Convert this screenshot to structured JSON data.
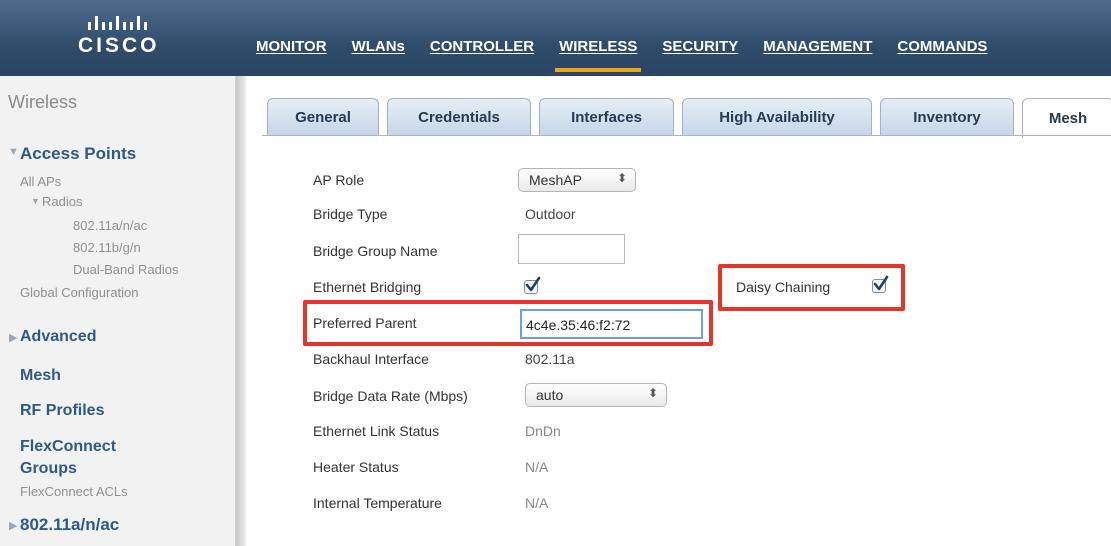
{
  "header": {
    "logo_text": "CISCO",
    "menu": [
      {
        "label": "MONITOR",
        "active": false
      },
      {
        "label": "WLANs",
        "active": false
      },
      {
        "label": "CONTROLLER",
        "active": false
      },
      {
        "label": "WIRELESS",
        "active": true
      },
      {
        "label": "SECURITY",
        "active": false
      },
      {
        "label": "MANAGEMENT",
        "active": false
      },
      {
        "label": "COMMANDS",
        "active": false
      }
    ]
  },
  "sidebar": {
    "title": "Wireless",
    "access_points": "Access Points",
    "all_aps": "All APs",
    "radios": "Radios",
    "radio_a": "802.11a/n/ac",
    "radio_b": "802.11b/g/n",
    "radio_dual": "Dual-Band Radios",
    "global_config": "Global Configuration",
    "advanced": "Advanced",
    "mesh": "Mesh",
    "rf_profiles": "RF Profiles",
    "flexconnect_1": "FlexConnect",
    "flexconnect_2": "Groups",
    "flexconnect_acls": "FlexConnect ACLs",
    "radio_section": "802.11a/n/ac"
  },
  "tabs": [
    {
      "label": "General",
      "active": false
    },
    {
      "label": "Credentials",
      "active": false
    },
    {
      "label": "Interfaces",
      "active": false
    },
    {
      "label": "High Availability",
      "active": false
    },
    {
      "label": "Inventory",
      "active": false
    },
    {
      "label": "Mesh",
      "active": true
    }
  ],
  "form": {
    "ap_role_label": "AP Role",
    "ap_role_value": "MeshAP",
    "bridge_type_label": "Bridge Type",
    "bridge_type_value": "Outdoor",
    "bridge_group_label": "Bridge Group Name",
    "bridge_group_value": "",
    "ethernet_bridging_label": "Ethernet Bridging",
    "ethernet_bridging_checked": true,
    "daisy_chaining_label": "Daisy Chaining",
    "daisy_chaining_checked": true,
    "preferred_parent_label": "Preferred Parent",
    "preferred_parent_value": "4c4e.35:46:f2:72",
    "backhaul_label": "Backhaul Interface",
    "backhaul_value": "802.11a",
    "bridge_rate_label": "Bridge Data Rate (Mbps)",
    "bridge_rate_value": "auto",
    "eth_link_label": "Ethernet Link Status",
    "eth_link_value": "DnDn",
    "heater_label": "Heater Status",
    "heater_value": "N/A",
    "temp_label": "Internal Temperature",
    "temp_value": "N/A"
  },
  "colors": {
    "header_bg": "#2f4c6b",
    "active_menu_underline": "#f0a21a",
    "highlight_border": "#e3352a",
    "sidebar_link": "#2c5a8a"
  }
}
